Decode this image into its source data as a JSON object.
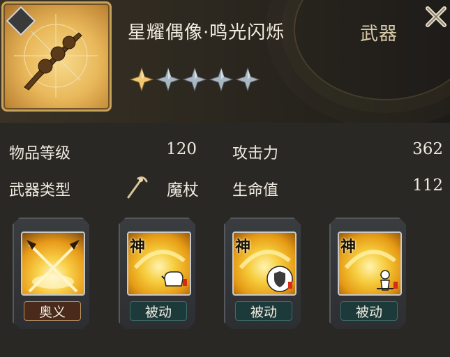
{
  "item": {
    "name": "星耀偶像·鸣光闪烁",
    "category": "武器",
    "stars_filled": 1,
    "stars_total": 5
  },
  "stats": {
    "item_level_label": "物品等级",
    "item_level_value": "120",
    "weapon_type_label": "武器类型",
    "weapon_type_value": "魔杖",
    "attack_label": "攻击力",
    "attack_value": "362",
    "hp_label": "生命值",
    "hp_value": "112"
  },
  "skills": [
    {
      "tag": "奥义",
      "icon": "crossed-staffs-icon",
      "divine": ""
    },
    {
      "tag": "被动",
      "icon": "teapot-icon",
      "divine": "神"
    },
    {
      "tag": "被动",
      "icon": "shield-icon",
      "divine": "神"
    },
    {
      "tag": "被动",
      "icon": "figure-icon",
      "divine": "神"
    }
  ],
  "colors": {
    "star_filled": "#f0c872",
    "star_empty": "#a9b7c3",
    "gold": "#e9b85b"
  }
}
